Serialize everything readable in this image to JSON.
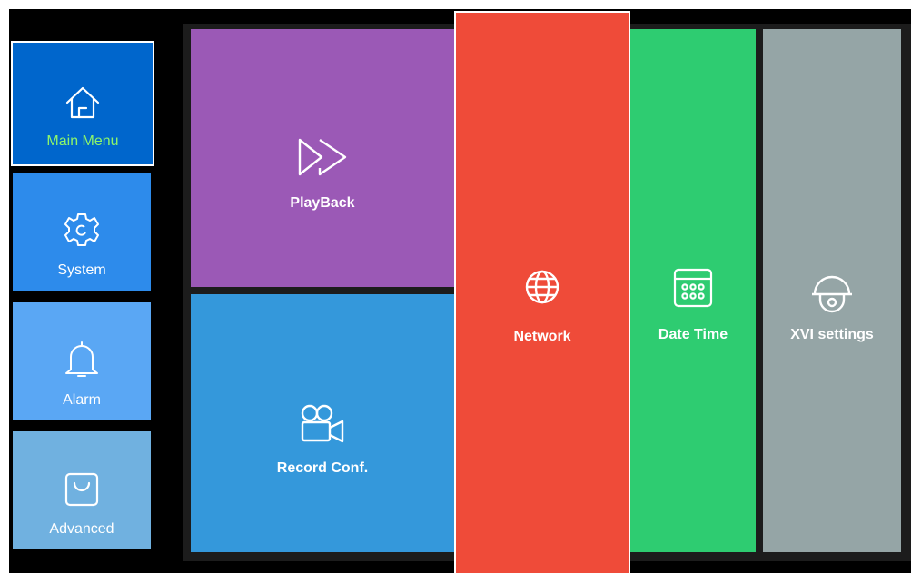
{
  "sidebar": {
    "items": [
      {
        "label": "Main Menu",
        "icon": "home-icon",
        "color": "#0066CC",
        "label_color": "#8DF56A",
        "selected": true
      },
      {
        "label": "System",
        "icon": "gear-icon",
        "color": "#2D8BEB"
      },
      {
        "label": "Alarm",
        "icon": "bell-icon",
        "color": "#5AA7F4"
      },
      {
        "label": "Advanced",
        "icon": "bag-icon",
        "color": "#70B1E0"
      }
    ]
  },
  "tiles": {
    "playback": {
      "label": "PlayBack",
      "icon": "fast-forward-icon",
      "color": "#9B59B6"
    },
    "record": {
      "label": "Record Conf.",
      "icon": "video-camera-icon",
      "color": "#3498DB"
    },
    "network": {
      "label": "Network",
      "icon": "globe-icon",
      "color": "#EF4B39"
    },
    "datetime": {
      "label": "Date Time",
      "icon": "calendar-icon",
      "color": "#2ECC71"
    },
    "xvi": {
      "label": "XVI settings",
      "icon": "dome-camera-icon",
      "color": "#95A5A6"
    }
  }
}
